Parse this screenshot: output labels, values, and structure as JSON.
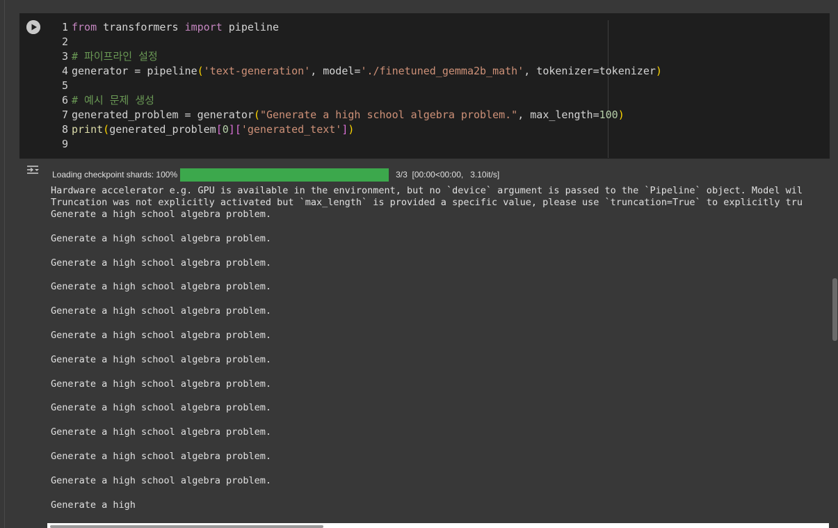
{
  "code_cell": {
    "line_numbers": [
      "1",
      "2",
      "3",
      "4",
      "5",
      "6",
      "7",
      "8",
      "9"
    ],
    "lines": {
      "l1": {
        "kw_from": "from",
        "mod": " transformers ",
        "kw_import": "import",
        "name": " pipeline"
      },
      "l3": {
        "comment": "# 파이프라인 설정"
      },
      "l4": {
        "a": "generator = pipeline",
        "p_open": "(",
        "s1": "'text-generation'",
        "b": ", model=",
        "s2": "'./finetuned_gemma2b_math'",
        "c": ", tokenizer=tokenizer",
        "p_close": ")"
      },
      "l6": {
        "comment": "# 예시 문제 생성"
      },
      "l7": {
        "a": "generated_problem = generator",
        "p_open": "(",
        "s1": "\"Generate a high school algebra problem.\"",
        "b": ", max_length=",
        "num": "100",
        "p_close": ")"
      },
      "l8": {
        "fn": "print",
        "p_open": "(",
        "arg": "generated_problem",
        "br1_open": "[",
        "idx": "0",
        "br1_close": "]",
        "br2_open": "[",
        "key": "'generated_text'",
        "br2_close": "]",
        "p_close": ")"
      }
    }
  },
  "progress": {
    "label": "Loading checkpoint shards: 100%",
    "fraction": 1.0,
    "count": "3/3",
    "timing": "[00:00<00:00,   3.10it/s]"
  },
  "output": {
    "warnings": [
      "Hardware accelerator e.g. GPU is available in the environment, but no `device` argument is passed to the `Pipeline` object. Model wil",
      "Truncation was not explicitly activated but `max_length` is provided a specific value, please use `truncation=True` to explicitly tru"
    ],
    "generated_lines": [
      "Generate a high school algebra problem.",
      "Generate a high school algebra problem.",
      "Generate a high school algebra problem.",
      "Generate a high school algebra problem.",
      "Generate a high school algebra problem.",
      "Generate a high school algebra problem.",
      "Generate a high school algebra problem.",
      "Generate a high school algebra problem.",
      "Generate a high school algebra problem.",
      "Generate a high school algebra problem.",
      "Generate a high school algebra problem.",
      "Generate a high school algebra problem.",
      "Generate a high"
    ]
  },
  "icons": {
    "run": "play-circle-icon",
    "output_toggle": "output-toggle-icon"
  },
  "colors": {
    "progress_fill": "#3ca84c",
    "editor_bg": "#1e1e1e",
    "output_bg": "#383838"
  }
}
